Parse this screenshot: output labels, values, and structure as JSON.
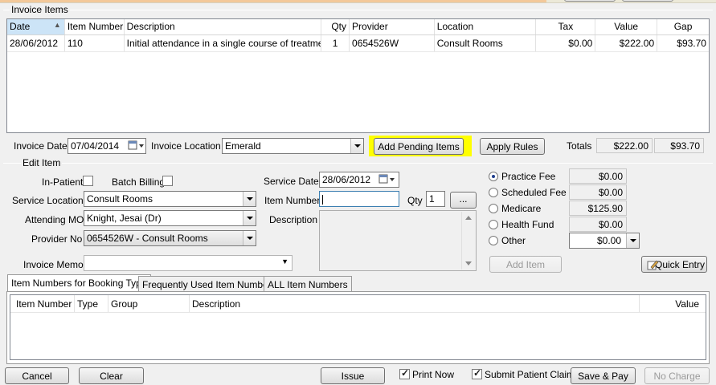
{
  "invoice_items": {
    "group_label": "Invoice Items",
    "columns": [
      "Date",
      "Item Number",
      "Description",
      "Qty",
      "Provider",
      "Location",
      "Tax",
      "Value",
      "Gap"
    ],
    "rows": [
      {
        "date": "28/06/2012",
        "item_number": "110",
        "description": "Initial attendance in a single course of treatment",
        "qty": "1",
        "provider": "0654526W",
        "location": "Consult Rooms",
        "tax": "$0.00",
        "value": "$222.00",
        "gap": "$93.70"
      }
    ]
  },
  "invoice": {
    "date_label": "Invoice Date",
    "date_value": "07/04/2014",
    "location_label": "Invoice Location",
    "location_value": "Emerald",
    "add_pending_label": "Add Pending Items",
    "apply_rules_label": "Apply Rules",
    "totals_label": "Totals",
    "total_value": "$222.00",
    "total_gap": "$93.70"
  },
  "edit_item": {
    "group_label": "Edit Item",
    "inpatient_label": "In-Patient",
    "batch_billing_label": "Batch Billing",
    "service_location_label": "Service Location",
    "service_location_value": "Consult Rooms",
    "attending_mo_label": "Attending MO",
    "attending_mo_value": "Knight, Jesai (Dr)",
    "provider_no_label": "Provider No",
    "provider_no_value": "0654526W - Consult Rooms",
    "invoice_memo_label": "Invoice Memo",
    "invoice_memo_value": "",
    "service_date_label": "Service Date",
    "service_date_value": "28/06/2012",
    "item_number_label": "Item Number",
    "item_number_value": "",
    "qty_label": "Qty",
    "qty_value": "1",
    "browse_label": "...",
    "description_label": "Description",
    "fees": [
      {
        "label": "Practice Fee",
        "value": "$0.00",
        "selected": true
      },
      {
        "label": "Scheduled Fee",
        "value": "$0.00",
        "selected": false
      },
      {
        "label": "Medicare",
        "value": "$125.90",
        "selected": false
      },
      {
        "label": "Health Fund",
        "value": "$0.00",
        "selected": false
      },
      {
        "label": "Other",
        "value": "$0.00",
        "selected": false
      }
    ],
    "add_item_label": "Add Item",
    "quick_entry_label": "Quick Entry"
  },
  "tabs": [
    "Item Numbers for Booking Type",
    "Frequently Used Item Numbers",
    "ALL Item Numbers"
  ],
  "item_table": {
    "columns": [
      "Item Number",
      "Type",
      "Group",
      "Description",
      "Value"
    ]
  },
  "footer": {
    "cancel_label": "Cancel",
    "clear_label": "Clear",
    "issue_label": "Issue",
    "print_now_label": "Print Now",
    "print_now_checked": true,
    "submit_claim_label": "Submit Patient Claim",
    "submit_claim_checked": true,
    "save_pay_label": "Save & Pay",
    "no_charge_label": "No Charge"
  },
  "colors": {
    "highlight": "#ffff00",
    "selection": "#cce4f7"
  }
}
